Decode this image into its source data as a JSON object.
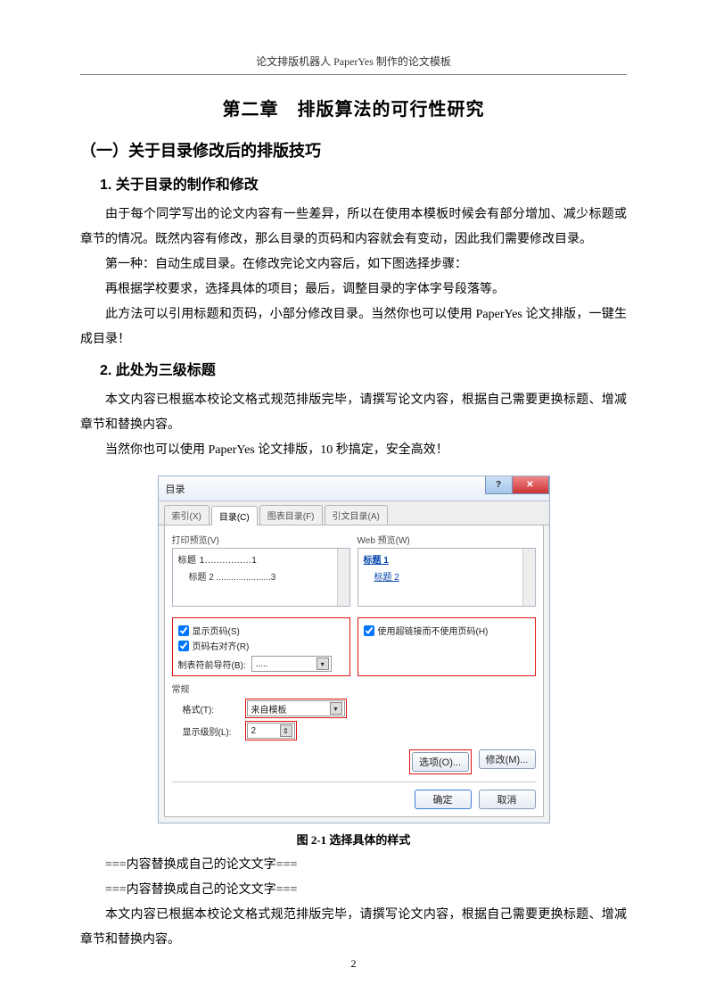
{
  "header": "论文排版机器人 PaperYes 制作的论文模板",
  "chapter_title": "第二章　排版算法的可行性研究",
  "section1": "（一）关于目录修改后的排版技巧",
  "sub1": "1. 关于目录的制作和修改",
  "para1": "由于每个同学写出的论文内容有一些差异，所以在使用本模板时候会有部分增加、减少标题或章节的情况。既然内容有修改，那么目录的页码和内容就会有变动，因此我们需要修改目录。",
  "para2": "第一种：自动生成目录。在修改完论文内容后，如下图选择步骤：",
  "para3": "再根据学校要求，选择具体的项目；最后，调整目录的字体字号段落等。",
  "para4": "此方法可以引用标题和页码，小部分修改目录。当然你也可以使用 PaperYes 论文排版，一键生成目录！",
  "sub2": "2. 此处为三级标题",
  "para5": "本文内容已根据本校论文格式规范排版完毕，请撰写论文内容，根据自己需要更换标题、增减章节和替换内容。",
  "para6": "当然你也可以使用 PaperYes 论文排版，10 秒搞定，安全高效！",
  "dialog": {
    "title": "目录",
    "help_btn": "?",
    "close_btn": "✕",
    "tabs": [
      "索引(X)",
      "目录(C)",
      "图表目录(F)",
      "引文目录(A)"
    ],
    "active_tab": 1,
    "left_label": "打印预览(V)",
    "right_label": "Web 预览(W)",
    "preview_line1": "标题 1................1",
    "preview_line2": "标题 2 ......................3",
    "web_link1": "标题 1",
    "web_link2": "标题 2",
    "ck_show_page": "显示页码(S)",
    "ck_right_align": "页码右对齐(R)",
    "tab_leader_label": "制表符前导符(B):",
    "tab_leader_value": ".....",
    "ck_hyperlink": "使用超链接而不使用页码(H)",
    "general_label": "常规",
    "format_label": "格式(T):",
    "format_value": "来自模板",
    "levels_label": "显示级别(L):",
    "levels_value": "2",
    "btn_options": "选项(O)...",
    "btn_modify": "修改(M)...",
    "btn_ok": "确定",
    "btn_cancel": "取消"
  },
  "caption": "图 2-1  选择具体的样式",
  "placeholder1": "===内容替换成自己的论文文字===",
  "placeholder2": "===内容替换成自己的论文文字===",
  "para7": "本文内容已根据本校论文格式规范排版完毕，请撰写论文内容，根据自己需要更换标题、增减章节和替换内容。",
  "page_number": "2"
}
